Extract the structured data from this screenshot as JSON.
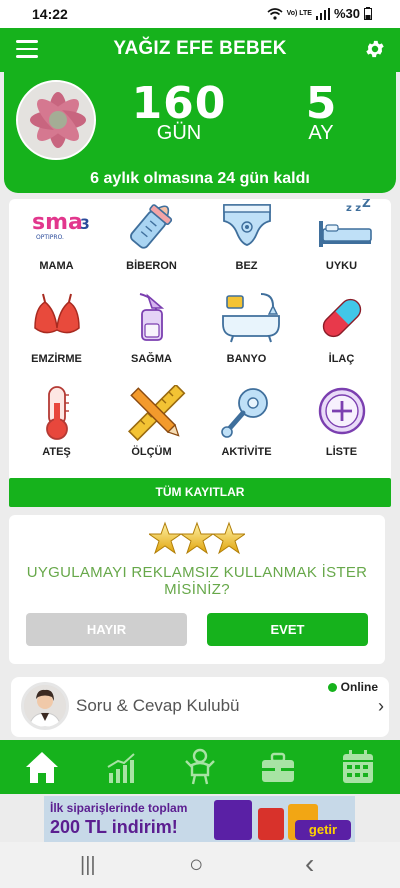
{
  "status_bar": {
    "time": "14:22",
    "network": "Vo) LTE",
    "battery": "%30"
  },
  "app_bar": {
    "title": "YAĞIZ EFE BEBEK",
    "menu_icon": "hamburger-menu-icon",
    "settings_icon": "gear-icon"
  },
  "hero": {
    "days_value": "160",
    "days_unit": "GÜN",
    "months_value": "5",
    "months_unit": "AY",
    "remaining_text": "6 aylık olmasına 24 gün kaldı"
  },
  "grid": {
    "items": [
      {
        "label": "MAMA",
        "icon": "sma-formula-logo-icon",
        "logo_text": "sma",
        "logo_num": "3",
        "logo_sub": "OPTIPRO."
      },
      {
        "label": "BİBERON",
        "icon": "baby-bottle-icon"
      },
      {
        "label": "BEZ",
        "icon": "diaper-icon"
      },
      {
        "label": "UYKU",
        "icon": "sleep-bed-icon"
      },
      {
        "label": "EMZİRME",
        "icon": "bra-icon"
      },
      {
        "label": "SAĞMA",
        "icon": "breast-pump-icon"
      },
      {
        "label": "BANYO",
        "icon": "bathtub-icon"
      },
      {
        "label": "İLAÇ",
        "icon": "pill-capsule-icon"
      },
      {
        "label": "ATEŞ",
        "icon": "thermometer-icon"
      },
      {
        "label": "ÖLÇÜM",
        "icon": "ruler-pencil-icon"
      },
      {
        "label": "AKTİVİTE",
        "icon": "rattle-icon"
      },
      {
        "label": "LİSTE",
        "icon": "plus-circle-icon"
      }
    ],
    "all_records_label": "TÜM KAYITLAR"
  },
  "promo": {
    "question": "UYGULAMAYI REKLAMSIZ KULLANMAK İSTER MİSİNİZ?",
    "no_label": "HAYIR",
    "yes_label": "EVET",
    "star_icon": "gold-star-icon"
  },
  "club": {
    "title": "Soru & Cevap Kulubü",
    "online_label": "Online",
    "chevron": "›"
  },
  "bottom_nav": {
    "tabs": [
      {
        "icon": "home-icon",
        "active": true
      },
      {
        "icon": "growth-chart-icon",
        "active": false
      },
      {
        "icon": "baby-icon",
        "active": false
      },
      {
        "icon": "briefcase-icon",
        "active": false
      },
      {
        "icon": "calendar-icon",
        "active": false
      }
    ]
  },
  "ad": {
    "line1": "İlk siparişlerinde toplam",
    "line2": "200 TL indirim!",
    "brand": "getir"
  },
  "system_nav": {
    "recents": "|||",
    "home": "○",
    "back": "‹"
  },
  "colors": {
    "brand_green": "#16b21c",
    "promo_text": "#67a84a",
    "no_button": "#cfcfcf"
  }
}
